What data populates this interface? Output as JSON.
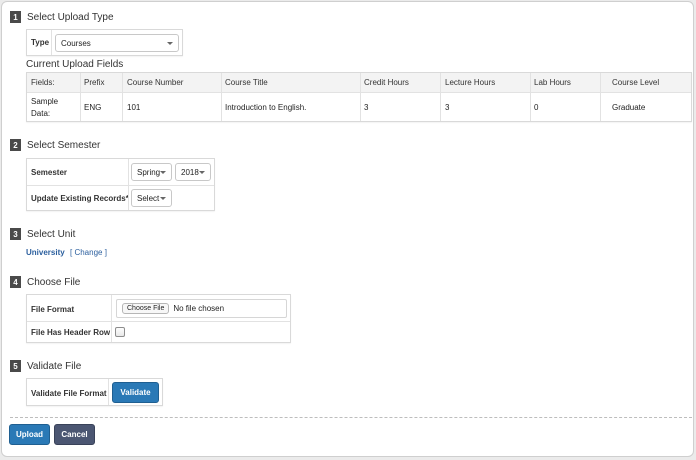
{
  "sections": {
    "s1": {
      "num": "1",
      "title": "Select Upload Type"
    },
    "s2": {
      "num": "2",
      "title": "Select Semester"
    },
    "s3": {
      "num": "3",
      "title": "Select Unit"
    },
    "s4": {
      "num": "4",
      "title": "Choose File"
    },
    "s5": {
      "num": "5",
      "title": "Validate File"
    }
  },
  "upload_type": {
    "label": "Type",
    "value": "Courses"
  },
  "current_fields": {
    "title": "Current Upload Fields",
    "headers": [
      "Fields:",
      "Prefix",
      "Course Number",
      "Course Title",
      "Credit Hours",
      "Lecture Hours",
      "Lab Hours",
      "Course Level"
    ],
    "sample_label_line1": "Sample",
    "sample_label_line2": "Data:",
    "sample": [
      "ENG",
      "101",
      "Introduction to English.",
      "3",
      "3",
      "0",
      "Graduate"
    ]
  },
  "semester": {
    "label": "Semester",
    "term": "Spring",
    "year": "2018",
    "update_label": "Update Existing Records*",
    "update_value": "Select"
  },
  "unit": {
    "name": "University",
    "change": "[ Change ]"
  },
  "file": {
    "format_label": "File Format",
    "choose_button": "Choose File",
    "chosen_text": "No file chosen",
    "header_row_label": "File Has Header Row"
  },
  "validate": {
    "label": "Validate File Format",
    "button": "Validate"
  },
  "actions": {
    "upload": "Upload",
    "cancel": "Cancel"
  },
  "colors": {
    "primary": "#2a79b6",
    "secondary": "#4b5672",
    "link": "#2b5f9e"
  }
}
